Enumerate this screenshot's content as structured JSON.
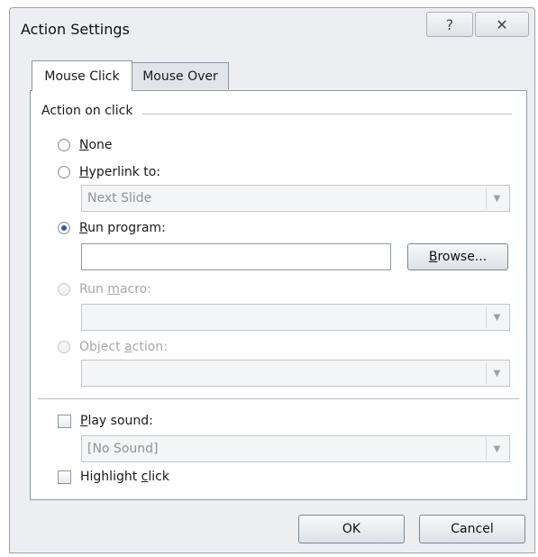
{
  "window": {
    "title": "Action Settings",
    "help_glyph": "?",
    "close_glyph": "✕"
  },
  "tabs": [
    {
      "label": "Mouse Click",
      "active": true
    },
    {
      "label": "Mouse Over",
      "active": false
    }
  ],
  "group": {
    "label": "Action on click"
  },
  "options": {
    "none": {
      "key": "N",
      "rest": "one",
      "selected": false,
      "enabled": true
    },
    "hyperlink": {
      "key": "H",
      "rest": "yperlink to:",
      "selected": false,
      "enabled": true,
      "value": "Next Slide"
    },
    "run_program": {
      "key": "R",
      "rest": "un program:",
      "selected": true,
      "enabled": true,
      "value": ""
    },
    "run_macro": {
      "pre": "Run ",
      "key": "m",
      "rest": "acro:",
      "selected": false,
      "enabled": false,
      "value": ""
    },
    "object_action": {
      "pre": "Object ",
      "key": "a",
      "rest": "ction:",
      "selected": false,
      "enabled": false,
      "value": ""
    }
  },
  "browse": {
    "key": "B",
    "rest": "rowse..."
  },
  "play_sound": {
    "key": "P",
    "rest": "lay sound:",
    "checked": false,
    "value": "[No Sound]"
  },
  "highlight": {
    "pre": "Highlight ",
    "key": "c",
    "rest": "lick",
    "checked": false
  },
  "buttons": {
    "ok": "OK",
    "cancel": "Cancel"
  },
  "colors": {
    "accent": "#2a5db0",
    "panel_bg": "#ffffff",
    "frame_bg": "#eceef1"
  }
}
